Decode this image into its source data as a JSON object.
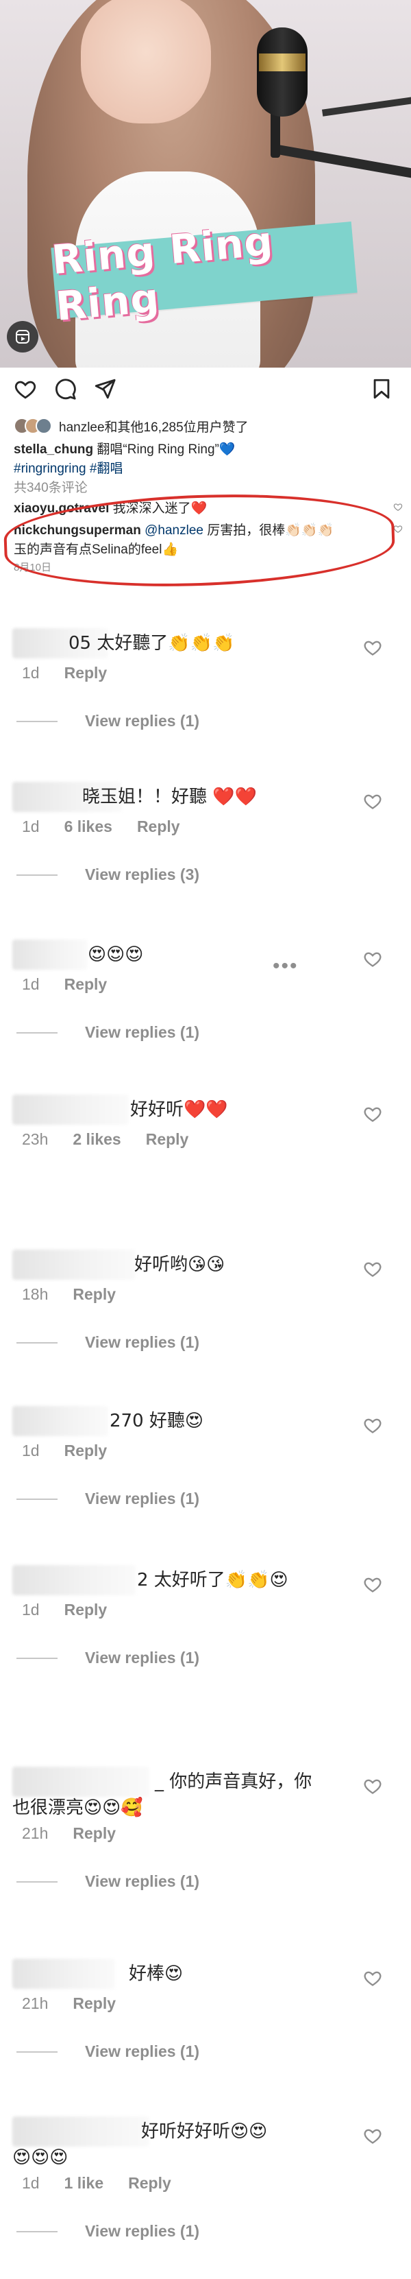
{
  "post": {
    "banner_text": "Ring Ring Ring",
    "liked_by": "hanzlee和其他16,285位用户赞了",
    "caption_user": "stella_chung",
    "caption_text": " 翻唱“Ring Ring Ring”💙",
    "hashtags": "#ringringring #翻唱",
    "comment_count": "共340条评论",
    "preview_comment_user": "xiaoyu.gotravel",
    "preview_comment_text": " 我深深入迷了❤️",
    "highlight_user": "nickchungsuperman",
    "highlight_mention": "@hanzlee",
    "highlight_text_1": " 厉害拍，很棒👏🏻👏🏻👏🏻",
    "highlight_text_2": "玉的声音有点Selina的feel👍",
    "date": "8月10日"
  },
  "comments": [
    {
      "text": "05 太好聽了👏👏👏",
      "time": "1d",
      "likes": "",
      "reply": "Reply",
      "view_replies": "View replies (1)"
    },
    {
      "text": "晓玉姐！！好聽 ❤️❤️",
      "time": "1d",
      "likes": "6 likes",
      "reply": "Reply",
      "view_replies": "View replies (3)"
    },
    {
      "text": "😍😍😍",
      "time": "1d",
      "likes": "",
      "reply": "Reply",
      "view_replies": "View replies (1)",
      "more": "•••"
    },
    {
      "text": "好好听❤️❤️",
      "time": "23h",
      "likes": "2 likes",
      "reply": "Reply",
      "view_replies": ""
    },
    {
      "text": "好听哟😘😘",
      "time": "18h",
      "likes": "",
      "reply": "Reply",
      "view_replies": "View replies (1)"
    },
    {
      "text": "270 好聽😍",
      "time": "1d",
      "likes": "",
      "reply": "Reply",
      "view_replies": "View replies (1)"
    },
    {
      "text": "2 太好听了👏👏😍",
      "time": "1d",
      "likes": "",
      "reply": "Reply",
      "view_replies": "View replies (1)"
    },
    {
      "text": "_ 你的声音真好，你",
      "text2": "也很漂亮😍😍🥰",
      "time": "21h",
      "likes": "",
      "reply": "Reply",
      "view_replies": "View replies (1)"
    },
    {
      "text": "好棒😍",
      "time": "21h",
      "likes": "",
      "reply": "Reply",
      "view_replies": "View replies (1)"
    },
    {
      "text": "好听好好听😍😍",
      "text2": "😍😍😍",
      "time": "1d",
      "likes": "1 like",
      "reply": "Reply",
      "view_replies": "View replies (1)"
    }
  ],
  "icons": [
    "heart-icon",
    "comment-icon",
    "share-icon",
    "bookmark-icon",
    "reels-icon"
  ],
  "colors": {
    "tag": "#00376b",
    "circle": "#d8302b",
    "banner": "#7fd3cc",
    "banner_shadow": "#e56c9e"
  }
}
